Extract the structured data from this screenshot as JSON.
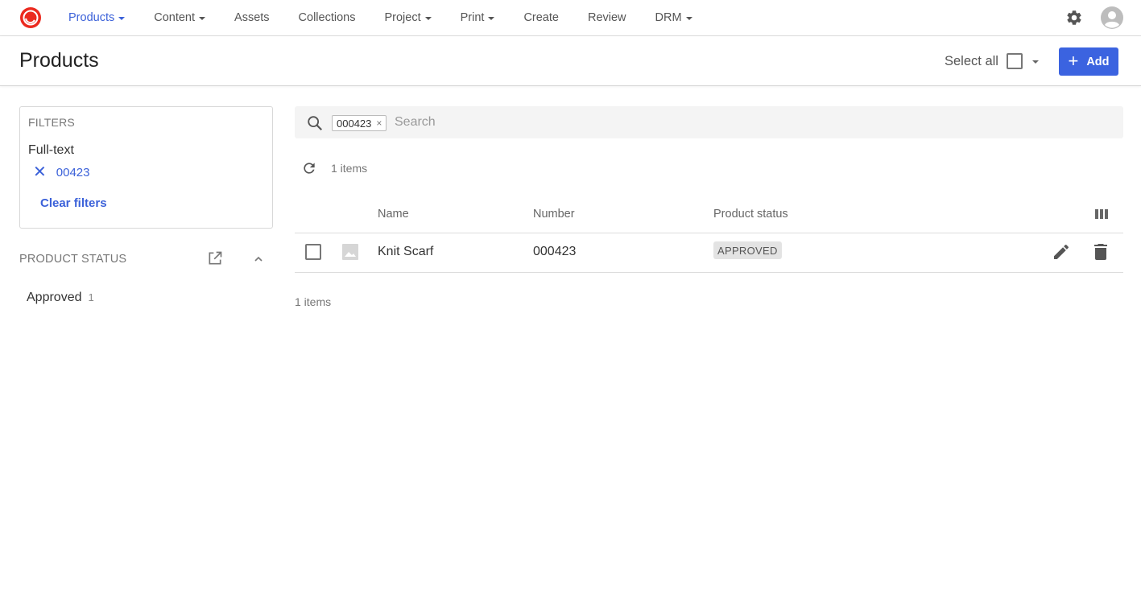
{
  "nav": {
    "items": [
      {
        "label": "Products",
        "dropdown": true,
        "active": true
      },
      {
        "label": "Content",
        "dropdown": true,
        "active": false
      },
      {
        "label": "Assets",
        "dropdown": false,
        "active": false
      },
      {
        "label": "Collections",
        "dropdown": false,
        "active": false
      },
      {
        "label": "Project",
        "dropdown": true,
        "active": false
      },
      {
        "label": "Print",
        "dropdown": true,
        "active": false
      },
      {
        "label": "Create",
        "dropdown": false,
        "active": false
      },
      {
        "label": "Review",
        "dropdown": false,
        "active": false
      },
      {
        "label": "DRM",
        "dropdown": true,
        "active": false
      }
    ],
    "accent_color": "#3b61d9",
    "logo_icon": "sitecore-logo-icon",
    "settings_icon": "gear-icon",
    "user_icon": "avatar-icon"
  },
  "header": {
    "title": "Products",
    "select_all_label": "Select all",
    "add_label": "Add",
    "add_button_color": "#3b63e0"
  },
  "filters": {
    "title": "FILTERS",
    "fulltext_label": "Full-text",
    "fulltext_value": "00423",
    "clear_label": "Clear filters"
  },
  "product_status": {
    "title": "PRODUCT STATUS",
    "items": [
      {
        "label": "Approved",
        "count": "1"
      }
    ]
  },
  "search": {
    "tag": "000423",
    "tag_remove": "×",
    "placeholder": "Search"
  },
  "results": {
    "count_top": "1 items",
    "count_bottom": "1 items",
    "columns": [
      "Name",
      "Number",
      "Product status"
    ],
    "rows": [
      {
        "name": "Knit Scarf",
        "number": "000423",
        "status": "APPROVED"
      }
    ]
  }
}
